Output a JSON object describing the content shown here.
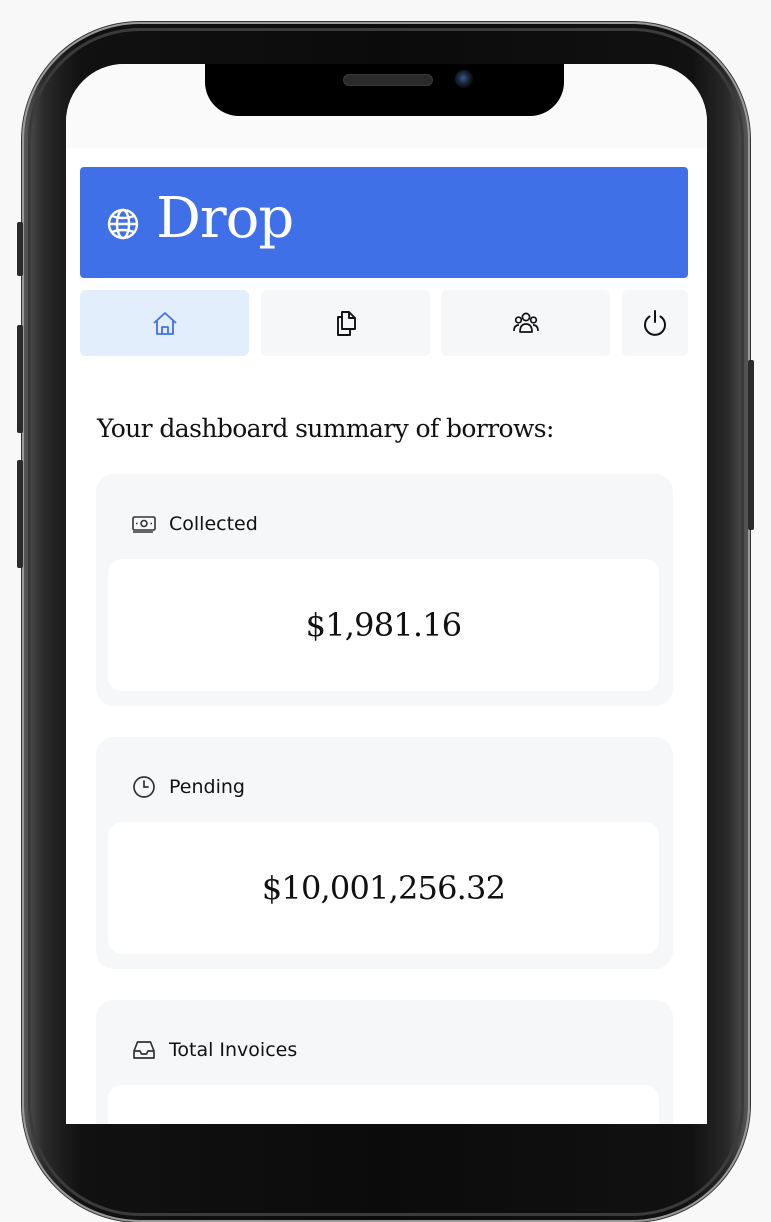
{
  "app": {
    "name": "Drop"
  },
  "nav": {
    "tabs": [
      {
        "icon": "home-icon",
        "active": true
      },
      {
        "icon": "documents-icon",
        "active": false
      },
      {
        "icon": "users-icon",
        "active": false
      },
      {
        "icon": "power-icon",
        "active": false
      }
    ]
  },
  "dashboard": {
    "intro": "Your dashboard summary of borrows:",
    "cards": [
      {
        "icon": "cash-icon",
        "label": "Collected",
        "value": "$1,981.16"
      },
      {
        "icon": "clock-icon",
        "label": "Pending",
        "value": "$10,001,256.32"
      },
      {
        "icon": "inbox-icon",
        "label": "Total Invoices",
        "value": ""
      }
    ]
  },
  "colors": {
    "brand": "#4070e8",
    "active_tab": "#e2eefc",
    "card_bg": "#f6f7f9",
    "icon_active": "#4070e8"
  }
}
